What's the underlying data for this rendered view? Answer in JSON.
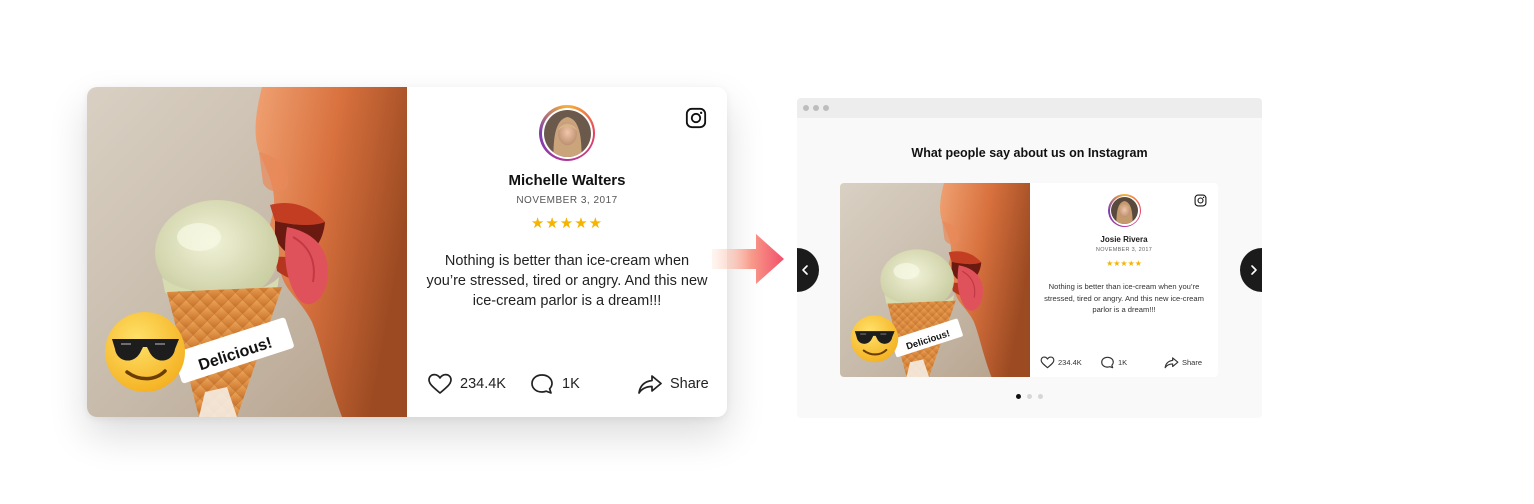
{
  "big_card": {
    "sticker_text": "Delicious!",
    "name": "Michelle Walters",
    "date": "NOVEMBER 3, 2017",
    "stars": "★★★★★",
    "review": "Nothing is better than ice-cream when you’re stressed, tired or angry. And this new ice-cream parlor is a dream!!!",
    "likes": "234.4K",
    "comments": "1K",
    "share_label": "Share"
  },
  "browser": {
    "title": "What people say about us on Instagram",
    "card": {
      "sticker_text": "Delicious!",
      "name": "Josie Rivera",
      "date": "NOVEMBER 3, 2017",
      "stars": "★★★★★",
      "review": "Nothing is better than ice-cream when you’re stressed, tired or angry. And this new ice-cream parlor is a dream!!!",
      "likes": "234.4K",
      "comments": "1K",
      "share_label": "Share"
    },
    "pager": {
      "total": 3,
      "active": 1
    }
  },
  "colors": {
    "star": "#f5b400",
    "nav_button": "#1b1b1b",
    "arrow": "#f2506a",
    "avatar_ring": [
      "#f9b233",
      "#e4405f",
      "#b1369a"
    ]
  },
  "icons": [
    "instagram-icon",
    "heart-icon",
    "comment-icon",
    "share-icon",
    "chevron-left-icon",
    "chevron-right-icon",
    "sunglasses-emoji-icon",
    "right-arrow-icon"
  ]
}
